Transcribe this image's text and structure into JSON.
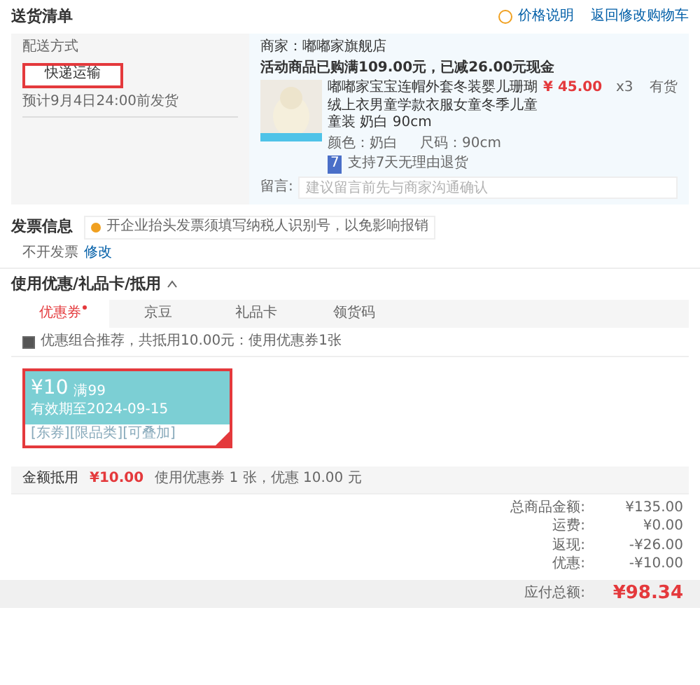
{
  "header": {
    "title": "送货清单",
    "price_note": "价格说明",
    "back_link": "返回修改购物车"
  },
  "delivery": {
    "label": "配送方式",
    "option": {
      "label": "快递运输",
      "selected": true
    },
    "estimate": "预计9月4日24:00前发货"
  },
  "shop": {
    "seller": "商家：嘟嘟家旗舰店",
    "promo": "活动商品已购满109.00元，已减26.00元现金",
    "item": {
      "name": "嘟嘟家宝宝连帽外套冬装婴儿珊瑚绒上衣男童学款衣服女童冬季儿童童装 奶白 90cm",
      "price": "¥ 45.00",
      "qty": "x3",
      "stock": "有货",
      "color_label": "颜色：奶白",
      "size": "尺码：90cm",
      "badge": "7",
      "return_policy": "支持7天无理由退货"
    },
    "note_label": "留言:",
    "note_placeholder": "建议留言前先与商家沟通确认"
  },
  "invoice": {
    "title": "发票信息",
    "tip": "开企业抬头发票须填写纳税人识别号，以免影响报销",
    "value": "不开发票",
    "edit": "修改"
  },
  "discount": {
    "title": "使用优惠/礼品卡/抵用",
    "expanded": true,
    "tabs": [
      {
        "label": "优惠券",
        "selected": true,
        "dot": true
      },
      {
        "label": "京豆",
        "selected": false,
        "dot": false
      },
      {
        "label": "礼品卡",
        "selected": false,
        "dot": false
      },
      {
        "label": "领货码",
        "selected": false,
        "dot": false
      }
    ],
    "combo": {
      "checked": true,
      "label": "优惠组合推荐，共抵用10.00元：使用优惠券1张"
    },
    "coupon": {
      "amount": "¥10",
      "condition": "满99",
      "expiry": "有效期至2024-09-15",
      "tags": [
        "[东券]",
        "[限品类]",
        "[可叠加]"
      ],
      "selected": true
    },
    "summary": {
      "label": "金额抵用",
      "amount": "¥10.00",
      "detail": "使用优惠券 1 张，优惠 10.00 元"
    }
  },
  "totals": [
    {
      "label": "总商品金额:",
      "value": "¥135.00"
    },
    {
      "label": "运费:",
      "value": "¥0.00"
    },
    {
      "label": "返现:",
      "value": "-¥26.00"
    },
    {
      "label": "优惠:",
      "value": "-¥10.00"
    }
  ],
  "payable": {
    "label": "应付总额:",
    "value": "¥98.34"
  }
}
